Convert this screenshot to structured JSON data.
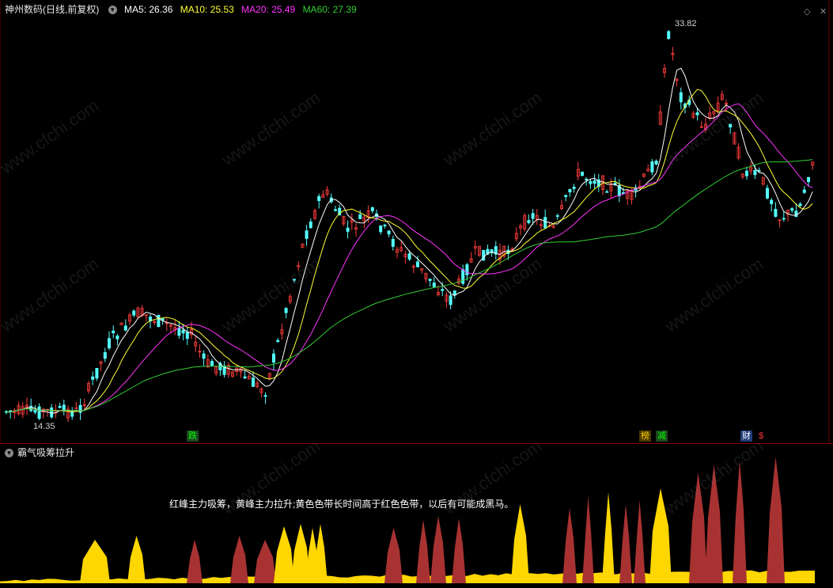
{
  "header": {
    "title": "神州数码(日线,前复权)",
    "ma5": {
      "label": "MA5:",
      "value": "26.36",
      "color": "#ffffff"
    },
    "ma10": {
      "label": "MA10:",
      "value": "25.53",
      "color": "#ffff33"
    },
    "ma20": {
      "label": "MA20:",
      "value": "25.49",
      "color": "#ff33ff"
    },
    "ma60": {
      "label": "MA60:",
      "value": "27.39",
      "color": "#33cc33"
    }
  },
  "price_chart": {
    "high_label": "33.82",
    "low_label": "14.35",
    "markers": [
      {
        "text": "跌",
        "color": "#00ff00",
        "bg": "#1e4620"
      },
      {
        "text": "榜",
        "color": "#ffcc00",
        "bg": "#4a3a00"
      },
      {
        "text": "减",
        "color": "#00ff00",
        "bg": "#1e4620"
      },
      {
        "text": "财",
        "color": "#ffffff",
        "bg": "#1f3b78"
      },
      {
        "text": "$",
        "color": "#ff3333",
        "bg": "transparent"
      }
    ],
    "colors": {
      "up": "#ff3c3c",
      "down": "#54ffff"
    }
  },
  "indicator": {
    "title": "霸气吸筹拉升",
    "note": "红峰主力吸筹，黄峰主力拉升;黄色色带长时间高于红色色带，以后有可能成黑马。",
    "colors": {
      "red": "#a83232",
      "yellow": "#ffd700"
    }
  },
  "watermark": "www.cfchi.com"
}
